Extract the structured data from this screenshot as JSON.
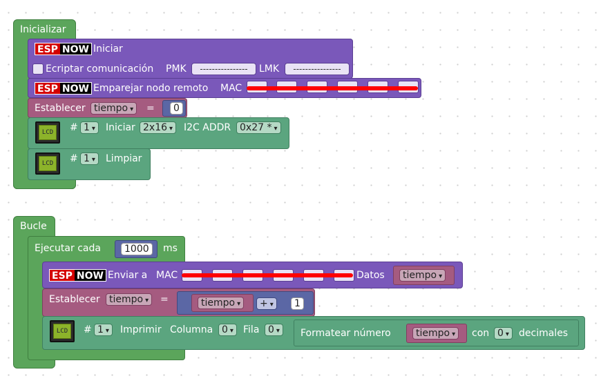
{
  "init_block": {
    "title": "Inicializar",
    "espnow_logo": {
      "esp": "ESP",
      "now": "NOW"
    },
    "iniciar_label": "Iniciar",
    "encrypt_label": "Ecriptar comunicación",
    "pmk_label": "PMK",
    "pmk_value": "----------------",
    "lmk_label": "LMK",
    "lmk_value": "----------------",
    "pair_label": "Emparejar nodo remoto",
    "mac_label": "MAC",
    "set_label": "Establecer",
    "var_name": "tiempo",
    "equals": "=",
    "init_value": "0",
    "lcd_icon_text": "LCD",
    "hash": "#",
    "lcd_index": "1",
    "lcd_init_label": "Iniciar",
    "lcd_size": "2x16",
    "i2c_label": "I2C ADDR",
    "i2c_addr": "0x27 *",
    "clear_label": "Limpiar"
  },
  "loop_block": {
    "title": "Bucle",
    "every_label": "Ejecutar cada",
    "interval": "1000",
    "ms_label": "ms",
    "send_label": "Enviar a",
    "mac_label": "MAC",
    "data_label": "Datos",
    "data_var": "tiempo",
    "set_label": "Establecer",
    "set_var": "tiempo",
    "equals": "=",
    "expr_var": "tiempo",
    "op": "+",
    "increment": "1",
    "hash": "#",
    "lcd_index": "1",
    "print_label": "Imprimir",
    "column_label": "Columna",
    "column_value": "0",
    "row_label": "Fila",
    "row_value": "0",
    "format_label": "Formatear número",
    "format_var": "tiempo",
    "with_label": "con",
    "decimals_value": "0",
    "decimals_label": "decimales"
  },
  "colors": {
    "control_green": "#5ba55b",
    "lcd_teal": "#5ba57f",
    "espnow_purple": "#7a58ba",
    "variable_rose": "#a55b80",
    "math_indigo": "#5b67a5",
    "redaction_red": "#ff0000"
  },
  "icons": [
    "espnow-logo",
    "lcd-icon",
    "checkbox",
    "dropdown-caret"
  ]
}
